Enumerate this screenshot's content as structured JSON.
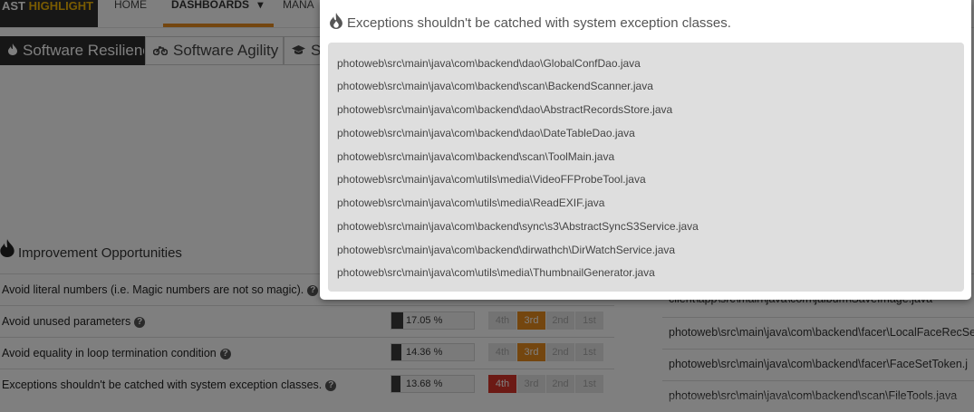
{
  "nav": {
    "logo_left": "AST",
    "logo_highlight": "HIGHLIGHT",
    "home": "HOME",
    "dashboards": "DASHBOARDS",
    "dashboards_caret": "▾",
    "manage": "MANA"
  },
  "tabs": [
    {
      "icon": "flame-icon",
      "label": "Software Resiliency"
    },
    {
      "icon": "motorbike-icon",
      "label": "Software Agility"
    },
    {
      "icon": "graduation-cap-icon",
      "label": "S"
    }
  ],
  "section": {
    "title": "Improvement Opportunities"
  },
  "table": {
    "rows": [
      {
        "label": "Avoid literal numbers (i.e. Magic numbers are not so magic).",
        "percent": "",
        "fill": 0,
        "rank": 0
      },
      {
        "label": "Avoid unused parameters",
        "percent": "17.05 %",
        "fill": 0.1705,
        "rank": 3
      },
      {
        "label": "Avoid equality in loop termination condition",
        "percent": "14.36 %",
        "fill": 0.1436,
        "rank": 3
      },
      {
        "label": "Exceptions shouldn't be catched with system exception classes.",
        "percent": "13.68 %",
        "fill": 0.1368,
        "rank": 4
      }
    ],
    "rank_labels": [
      "4th",
      "3rd",
      "2nd",
      "1st"
    ],
    "help_icon": "?"
  },
  "right_list": [
    "client\\app\\src\\main\\java\\com\\jalbum\\SaveImage.java",
    "photoweb\\src\\main\\java\\com\\backend\\facer\\LocalFaceRecSe",
    "photoweb\\src\\main\\java\\com\\backend\\facer\\FaceSetToken.j",
    "photoweb\\src\\main\\java\\com\\backend\\scan\\FileTools.java"
  ],
  "modal": {
    "title": "Exceptions shouldn't be catched with system exception classes.",
    "files": [
      "photoweb\\src\\main\\java\\com\\backend\\dao\\GlobalConfDao.java",
      "photoweb\\src\\main\\java\\com\\backend\\scan\\BackendScanner.java",
      "photoweb\\src\\main\\java\\com\\backend\\dao\\AbstractRecordsStore.java",
      "photoweb\\src\\main\\java\\com\\backend\\dao\\DateTableDao.java",
      "photoweb\\src\\main\\java\\com\\backend\\scan\\ToolMain.java",
      "photoweb\\src\\main\\java\\com\\utils\\media\\VideoFFProbeTool.java",
      "photoweb\\src\\main\\java\\com\\utils\\media\\ReadEXIF.java",
      "photoweb\\src\\main\\java\\com\\backend\\sync\\s3\\AbstractSyncS3Service.java",
      "photoweb\\src\\main\\java\\com\\backend\\dirwathch\\DirWatchService.java",
      "photoweb\\src\\main\\java\\com\\utils\\media\\ThumbnailGenerator.java"
    ]
  },
  "colors": {
    "accent": "#e98c1f",
    "danger": "#d9342b",
    "logo_highlight": "#f2b705"
  }
}
